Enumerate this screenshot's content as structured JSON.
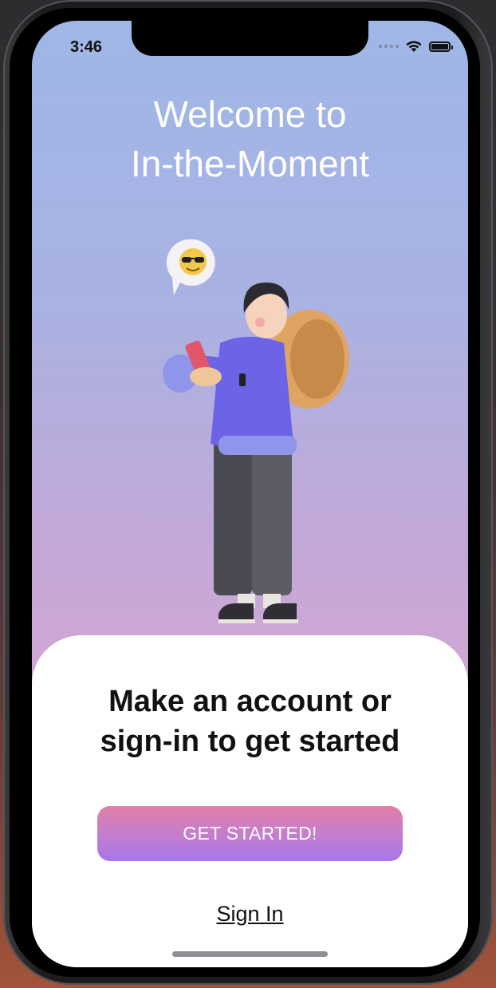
{
  "status_bar": {
    "time": "3:46"
  },
  "welcome": {
    "line1": "Welcome to",
    "line2": "In-the-Moment"
  },
  "illustration": {
    "bubble_icon": "sunglasses-emoji-icon",
    "figure": "person-with-phone-and-backpack"
  },
  "card": {
    "heading_line1": "Make an account or",
    "heading_line2": "sign-in to get started",
    "get_started_label": "GET STARTED!",
    "sign_in_label": "Sign In"
  },
  "colors": {
    "bg_top": "#9fb6e6",
    "bg_bottom": "#dba4cf",
    "button_top": "#e27fa6",
    "button_bottom": "#a577ea"
  }
}
